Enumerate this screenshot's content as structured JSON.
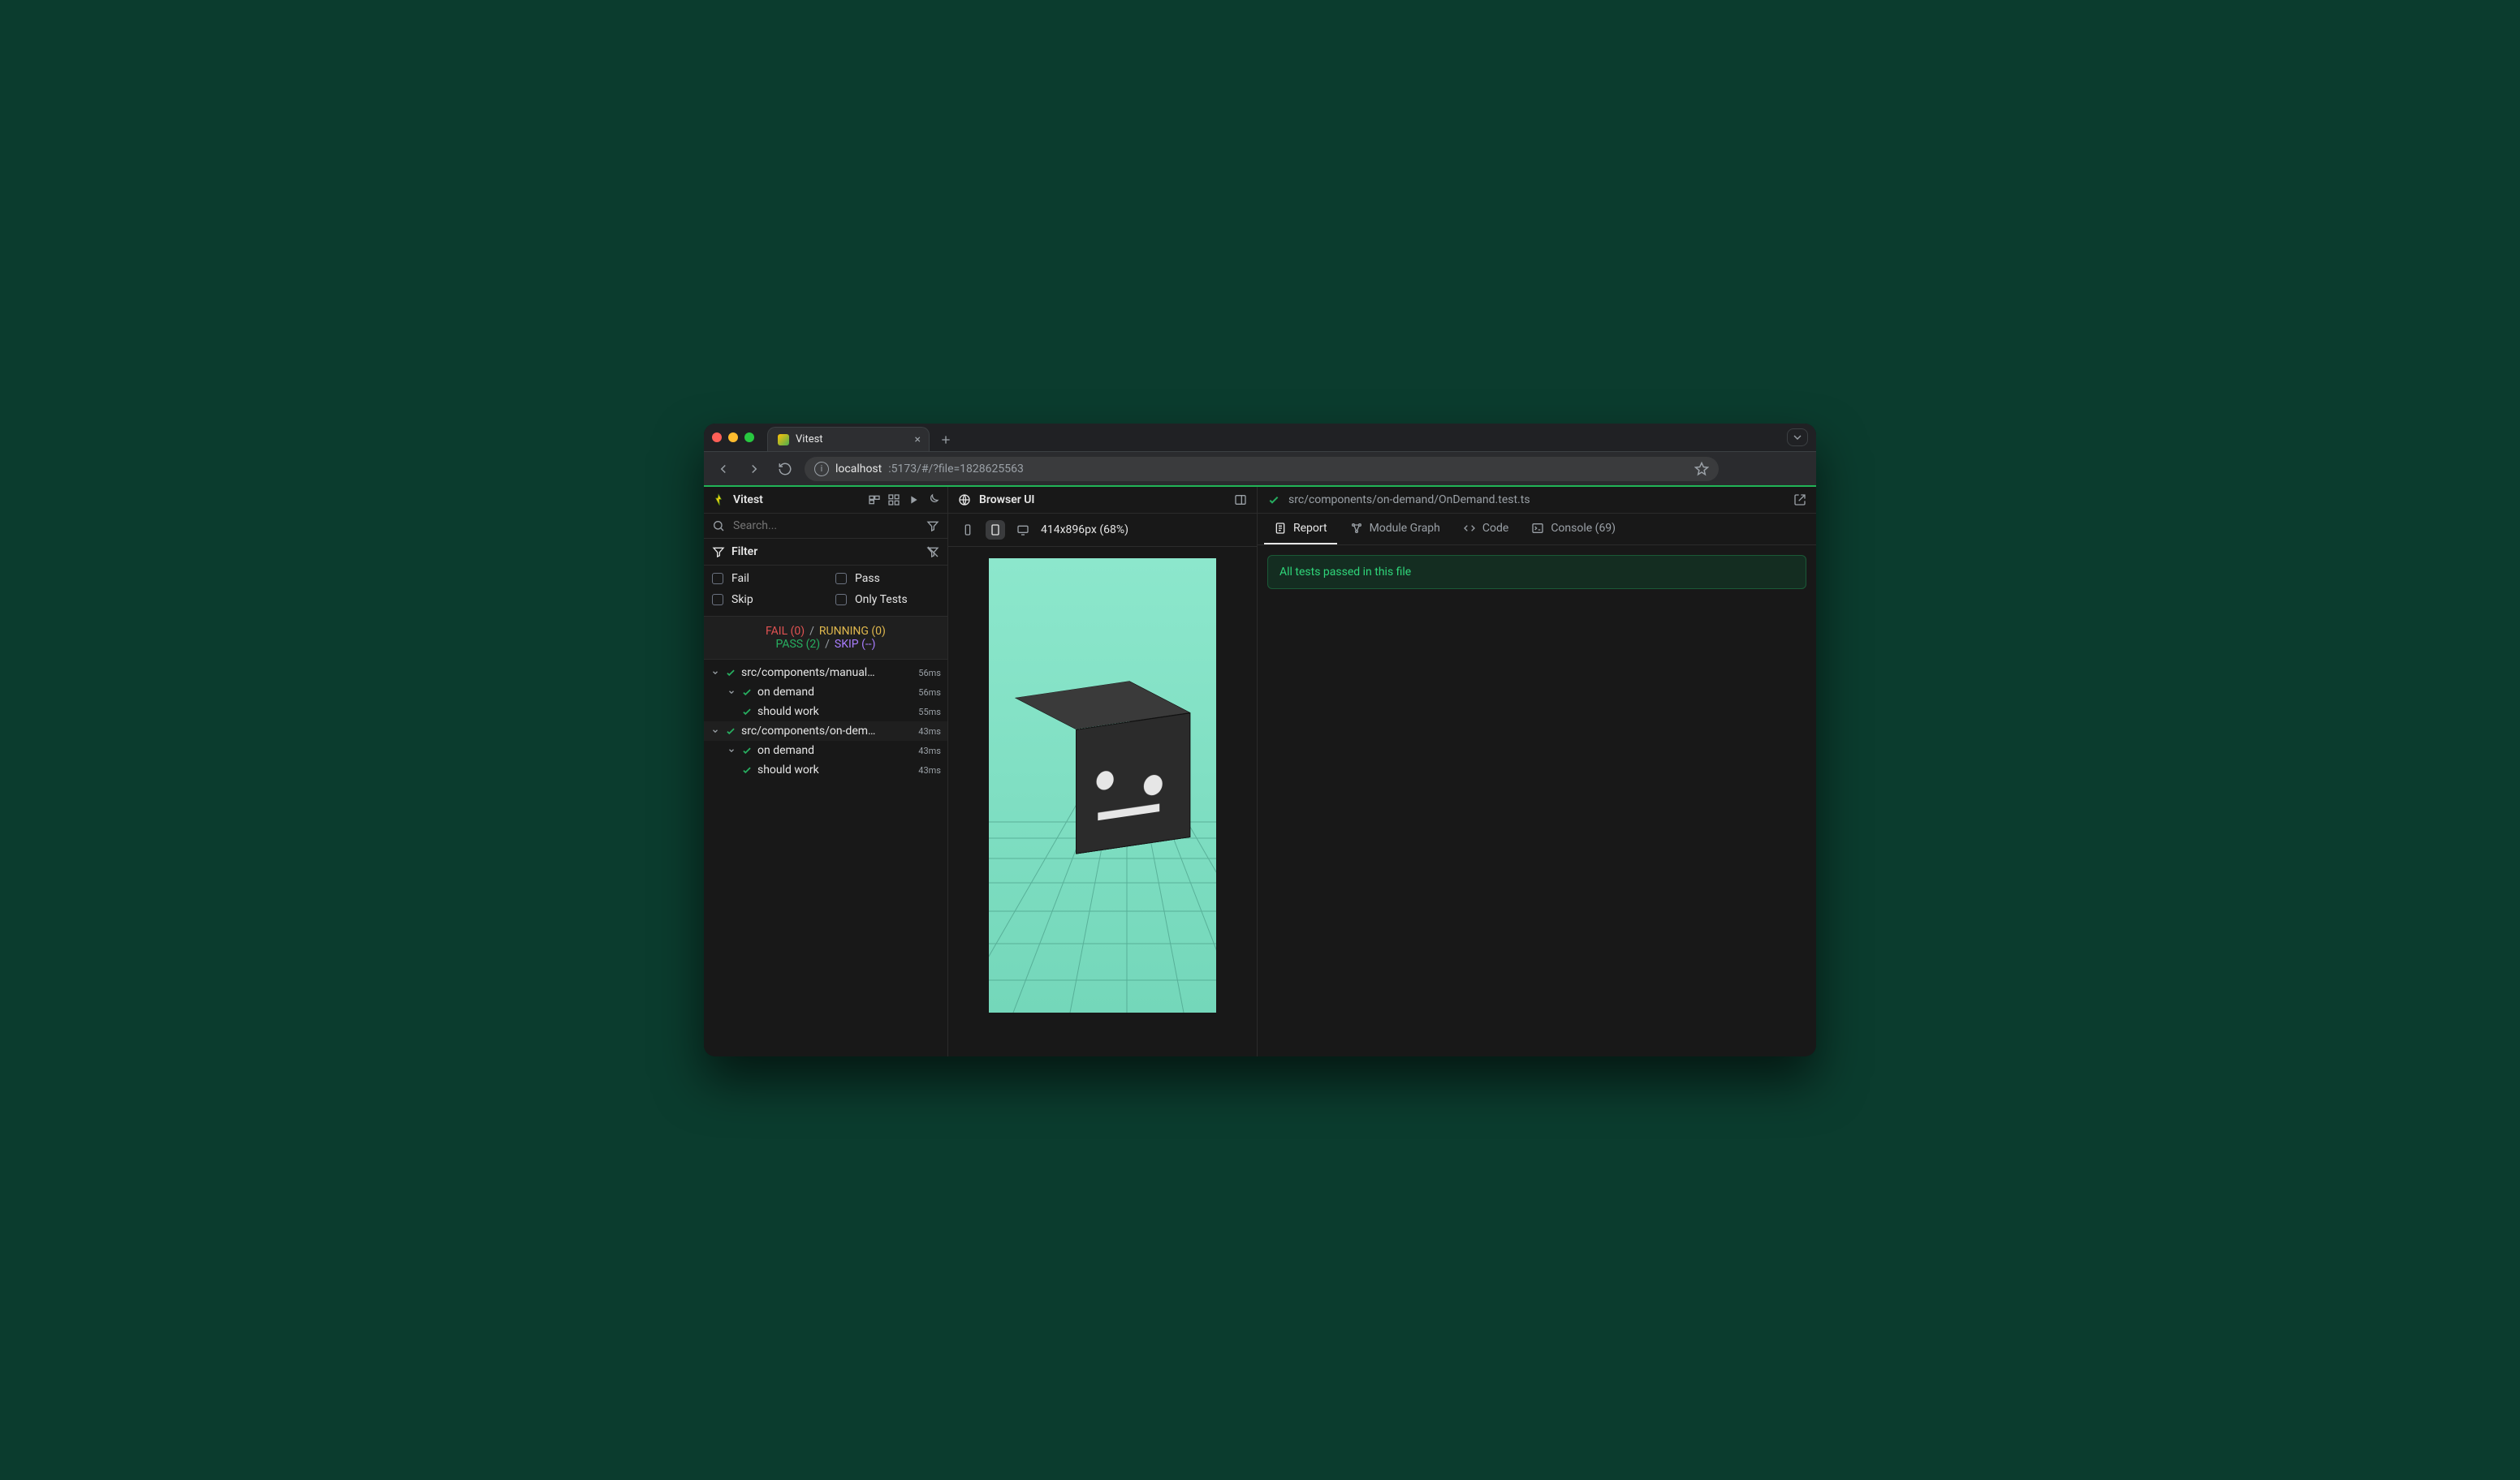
{
  "browser": {
    "tab_title": "Vitest",
    "url_host": "localhost",
    "url_rest": ":5173/#/?file=1828625563"
  },
  "sidebar": {
    "title": "Vitest",
    "search_placeholder": "Search...",
    "filter_label": "Filter",
    "filters": {
      "fail": "Fail",
      "pass": "Pass",
      "skip": "Skip",
      "only": "Only Tests"
    },
    "stats": {
      "fail": "FAIL (0)",
      "running": "RUNNING (0)",
      "pass": "PASS (2)",
      "skip": "SKIP (--)",
      "sep": "/"
    },
    "tree": [
      {
        "label": "src/components/manual/…",
        "time": "56ms",
        "children": [
          {
            "label": "on demand",
            "time": "56ms",
            "children": [
              {
                "label": "should work",
                "time": "55ms"
              }
            ]
          }
        ]
      },
      {
        "label": "src/components/on-dema…",
        "time": "43ms",
        "selected": true,
        "children": [
          {
            "label": "on demand",
            "time": "43ms",
            "children": [
              {
                "label": "should work",
                "time": "43ms"
              }
            ]
          }
        ]
      }
    ]
  },
  "preview": {
    "header_title": "Browser UI",
    "dimensions": "414x896px (68%)"
  },
  "report": {
    "file_path": "src/components/on-demand/OnDemand.test.ts",
    "tabs": {
      "report": "Report",
      "module_graph": "Module Graph",
      "code": "Code",
      "console": "Console (69)"
    },
    "banner": "All tests passed in this file"
  },
  "colors": {
    "fail": "#e05252",
    "running": "#e0b84e",
    "pass": "#27ae60",
    "skip": "#a97dff"
  }
}
